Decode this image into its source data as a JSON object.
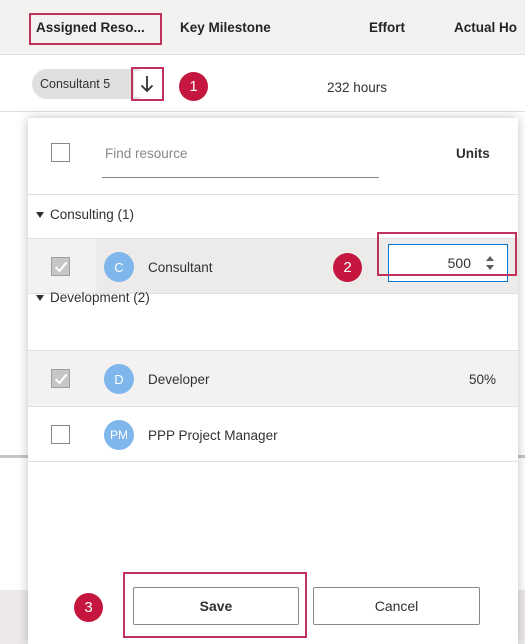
{
  "grid": {
    "columns": [
      "Assigned Reso...",
      "Key Milestone",
      "Effort",
      "Actual Ho"
    ],
    "row": {
      "assignee_pill": "Consultant 5",
      "effort": "232 hours"
    }
  },
  "picker": {
    "search_placeholder": "Find resource",
    "units_header": "Units",
    "groups": [
      {
        "label": "Consulting (1)",
        "resources": [
          {
            "initials": "C",
            "name": "Consultant",
            "checked": true,
            "units": "500"
          }
        ]
      },
      {
        "label": "Development (2)",
        "resources": [
          {
            "initials": "D",
            "name": "Developer",
            "checked": true,
            "units": "50%"
          },
          {
            "initials": "PM",
            "name": "PPP Project Manager",
            "checked": false,
            "units": ""
          }
        ]
      }
    ],
    "save_label": "Save",
    "cancel_label": "Cancel"
  },
  "callouts": [
    "1",
    "2",
    "3"
  ],
  "colors": {
    "callout": "#c4163e",
    "highlight_box": "#c0315b",
    "avatar": "#7fb7ec",
    "focus": "#0078d4"
  }
}
